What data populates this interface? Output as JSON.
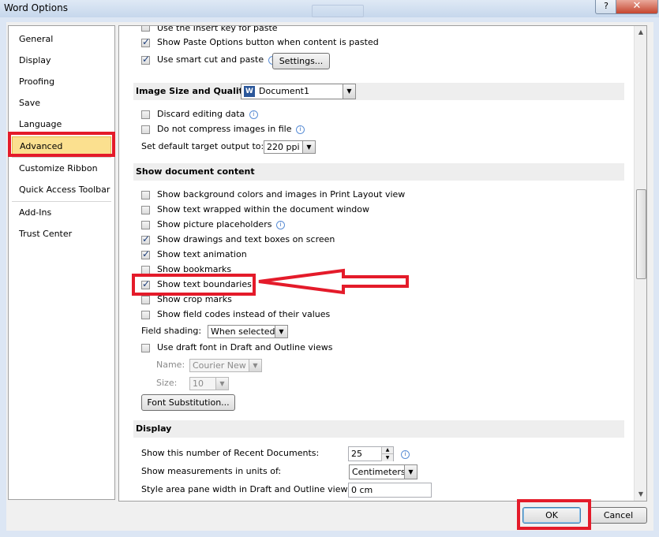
{
  "window": {
    "title": "Word Options",
    "help": "?",
    "close": "✕"
  },
  "nav": {
    "items": [
      {
        "label": "General"
      },
      {
        "label": "Display"
      },
      {
        "label": "Proofing"
      },
      {
        "label": "Save"
      },
      {
        "label": "Language"
      },
      {
        "label": "Advanced",
        "selected": true
      },
      {
        "label": "Customize Ribbon"
      },
      {
        "label": "Quick Access Toolbar"
      },
      {
        "label": "Add-Ins"
      },
      {
        "label": "Trust Center"
      }
    ]
  },
  "editing": {
    "use_insert_key": {
      "label": "Use the Insert key for paste",
      "checked": false
    },
    "show_paste_options": {
      "label": "Show Paste Options button when content is pasted",
      "checked": true
    },
    "smart_cut": {
      "label": "Use smart cut and paste",
      "checked": true
    },
    "settings_button": "Settings..."
  },
  "image_size": {
    "header": "Image Size and Quality",
    "document": "Document1",
    "discard_editing": {
      "label": "Discard editing data",
      "checked": false
    },
    "no_compress": {
      "label": "Do not compress images in file",
      "checked": false
    },
    "target_output_label": "Set default target output to:",
    "target_output_value": "220 ppi"
  },
  "show_content": {
    "header": "Show document content",
    "items": [
      {
        "label": "Show background colors and images in Print Layout view",
        "checked": false
      },
      {
        "label": "Show text wrapped within the document window",
        "checked": false
      },
      {
        "label": "Show picture placeholders",
        "checked": false,
        "info": true
      },
      {
        "label": "Show drawings and text boxes on screen",
        "checked": true
      },
      {
        "label": "Show text animation",
        "checked": true
      },
      {
        "label": "Show bookmarks",
        "checked": false
      },
      {
        "label": "Show text boundaries",
        "checked": true
      },
      {
        "label": "Show crop marks",
        "checked": false
      },
      {
        "label": "Show field codes instead of their values",
        "checked": false
      }
    ],
    "field_shading_label": "Field shading:",
    "field_shading_value": "When selected",
    "draft_font": {
      "label": "Use draft font in Draft and Outline views",
      "checked": false
    },
    "name_label": "Name:",
    "name_value": "Courier New",
    "size_label": "Size:",
    "size_value": "10",
    "font_sub_button": "Font Substitution..."
  },
  "display": {
    "header": "Display",
    "recent_docs_label": "Show this number of Recent Documents:",
    "recent_docs_value": "25",
    "measurements_label": "Show measurements in units of:",
    "measurements_value": "Centimeters",
    "style_area_label": "Style area pane width in Draft and Outline views:",
    "style_area_value": "0 cm"
  },
  "footer": {
    "ok": "OK",
    "cancel": "Cancel"
  },
  "info_glyph": "i",
  "dropdown_glyph": "▼",
  "spin_up": "▲",
  "spin_down": "▼",
  "highlight_color": "#e41b2a"
}
